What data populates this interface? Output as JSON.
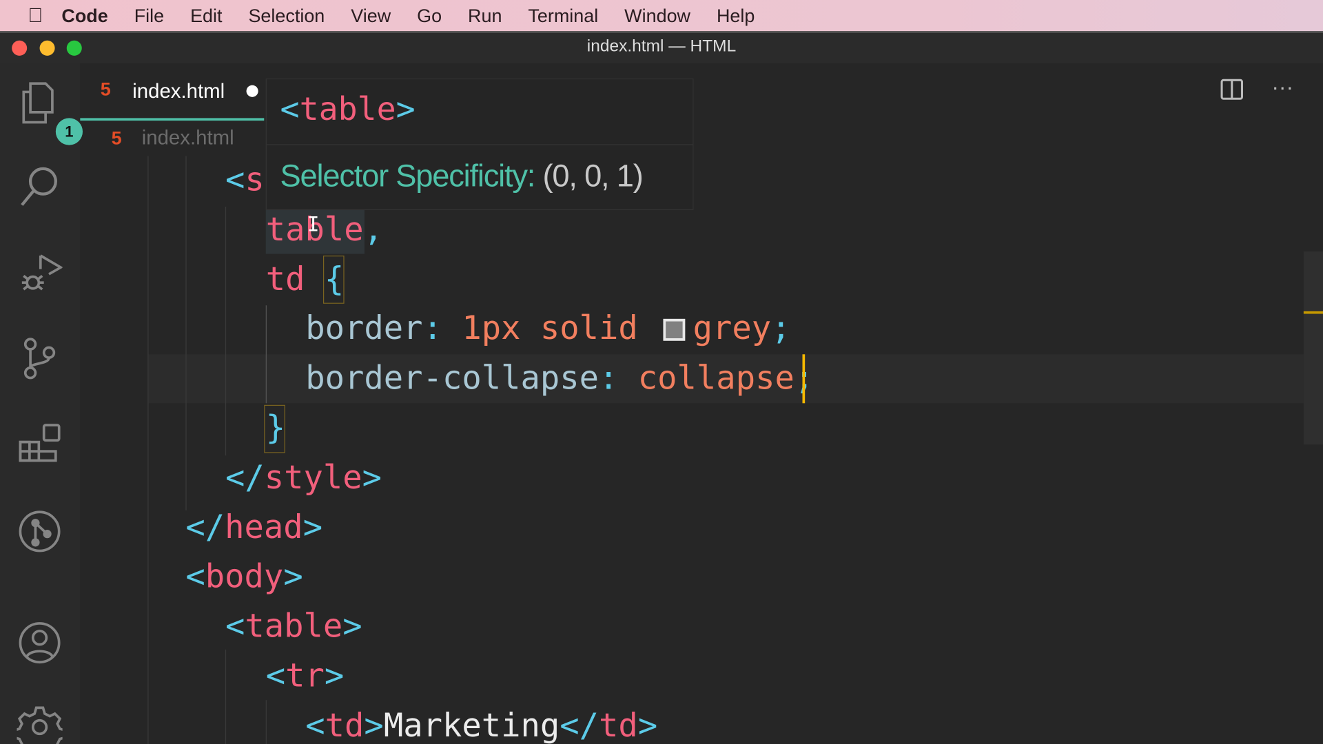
{
  "menubar": {
    "app": "Code",
    "items": [
      "File",
      "Edit",
      "Selection",
      "View",
      "Go",
      "Run",
      "Terminal",
      "Window",
      "Help"
    ]
  },
  "window": {
    "title": "index.html — HTML"
  },
  "activity_bar": {
    "explorer_badge": "1"
  },
  "tab": {
    "label": "index.html",
    "icon": "html5-icon",
    "dirty": true
  },
  "breadcrumb": {
    "file": "index.html"
  },
  "hover": {
    "code": {
      "open": "<",
      "tag": "table",
      "close": ">"
    },
    "label": "Selector Specificity:",
    "value": "(0, 0, 1)"
  },
  "editor": {
    "lines": [
      [
        {
          "t": "<",
          "c": "p"
        },
        {
          "t": "s",
          "c": "tag"
        }
      ],
      [
        {
          "t": "table",
          "c": "tag"
        },
        {
          "t": ",",
          "c": "p"
        }
      ],
      [
        {
          "t": "td ",
          "c": "tag"
        },
        {
          "t": "{",
          "c": "p"
        }
      ],
      [
        {
          "t": "border",
          "c": "prop"
        },
        {
          "t": ": ",
          "c": "p"
        },
        {
          "t": "1px solid ",
          "c": "val"
        },
        {
          "swatch": "#808080"
        },
        {
          "t": "grey",
          "c": "val"
        },
        {
          "t": ";",
          "c": "p"
        }
      ],
      [
        {
          "t": "border-collapse",
          "c": "prop"
        },
        {
          "t": ": ",
          "c": "p"
        },
        {
          "t": "collapse",
          "c": "val"
        },
        {
          "t": ";",
          "c": "p"
        }
      ],
      [
        {
          "t": "}",
          "c": "p"
        }
      ],
      [
        {
          "t": "</",
          "c": "p"
        },
        {
          "t": "style",
          "c": "tag"
        },
        {
          "t": ">",
          "c": "p"
        }
      ],
      [
        {
          "t": "</",
          "c": "p"
        },
        {
          "t": "head",
          "c": "tag"
        },
        {
          "t": ">",
          "c": "p"
        }
      ],
      [
        {
          "t": "<",
          "c": "p"
        },
        {
          "t": "body",
          "c": "tag"
        },
        {
          "t": ">",
          "c": "p"
        }
      ],
      [
        {
          "t": "<",
          "c": "p"
        },
        {
          "t": "table",
          "c": "tag"
        },
        {
          "t": ">",
          "c": "p"
        }
      ],
      [
        {
          "t": "<",
          "c": "p"
        },
        {
          "t": "tr",
          "c": "tag"
        },
        {
          "t": ">",
          "c": "p"
        }
      ],
      [
        {
          "t": "<",
          "c": "p"
        },
        {
          "t": "td",
          "c": "tag"
        },
        {
          "t": ">",
          "c": "p"
        },
        {
          "t": "Marketing",
          "c": "text"
        },
        {
          "t": "</",
          "c": "p"
        },
        {
          "t": "td",
          "c": "tag"
        },
        {
          "t": ">",
          "c": "p"
        }
      ]
    ]
  }
}
